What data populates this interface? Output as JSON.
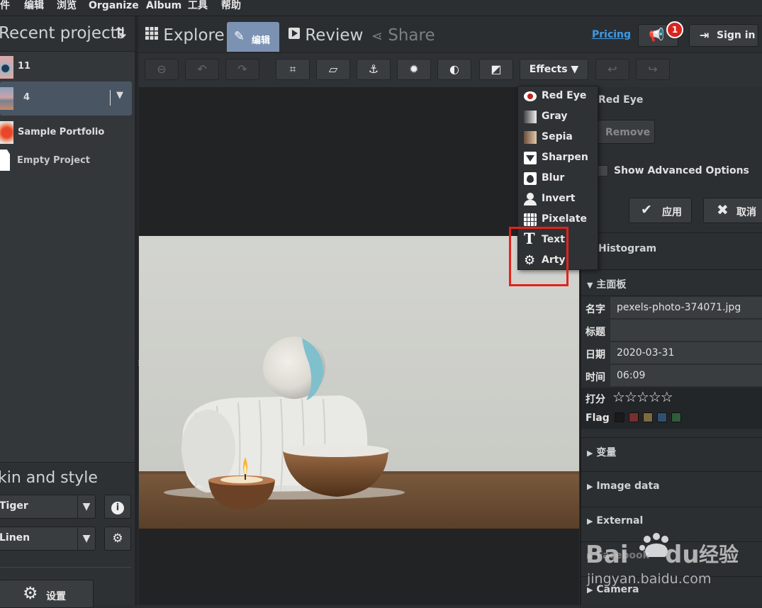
{
  "menubar": {
    "items": [
      "件",
      "编辑",
      "浏览",
      "Organize",
      "Album",
      "工具",
      "帮助"
    ]
  },
  "left": {
    "title": "Recent projects",
    "projects": [
      {
        "label": "11"
      },
      {
        "label": "4"
      },
      {
        "label": "Sample Portfolio"
      },
      {
        "label": "Empty Project"
      }
    ],
    "skin_title": "kin and style",
    "skin_value": "Tiger",
    "style_value": "Linen",
    "settings_label": "设置"
  },
  "tabs": {
    "explore": "Explore",
    "edit": "编辑",
    "review": "Review",
    "share": "Share"
  },
  "header": {
    "pricing": "Pricing",
    "notif_count": "1",
    "signin": "Sign in"
  },
  "toolbar": {
    "effects": "Effects"
  },
  "effects_menu": {
    "items": [
      {
        "label": "Red Eye",
        "icon": "red-eye-icon"
      },
      {
        "label": "Gray",
        "icon": "gray-icon"
      },
      {
        "label": "Sepia",
        "icon": "sepia-icon"
      },
      {
        "label": "Sharpen",
        "icon": "sharpen-icon"
      },
      {
        "label": "Blur",
        "icon": "blur-icon"
      },
      {
        "label": "Invert",
        "icon": "invert-icon"
      },
      {
        "label": "Pixelate",
        "icon": "pixelate-icon"
      },
      {
        "label": "Text",
        "icon": "text-icon"
      },
      {
        "label": "Arty",
        "icon": "arty-icon"
      }
    ]
  },
  "right": {
    "redeye_title": "Red Eye",
    "remove": "Remove",
    "advanced": "Show Advanced Options",
    "apply": "应用",
    "cancel": "取消",
    "histogram": "Histogram",
    "main_panel": "主面板",
    "props": [
      {
        "key": "名字",
        "value": "pexels-photo-374071.jpg"
      },
      {
        "key": "标题",
        "value": ""
      },
      {
        "key": "日期",
        "value": "2020-03-31"
      },
      {
        "key": "时间",
        "value": "06:09"
      }
    ],
    "rating_label": "打分",
    "rating": "0 of 5",
    "flag_label": "Flag",
    "flag_colors": [
      "#1a1a1a",
      "#7a2e2e",
      "#7d6a3f",
      "#2f5170",
      "#2f5c3a"
    ],
    "sections": [
      "变量",
      "Image data",
      "External",
      "Facebook",
      "Camera"
    ]
  },
  "watermark": {
    "brand": "Bai",
    "brand2": "du",
    "cn": "经验",
    "url": "jingyan.baidu.com"
  }
}
